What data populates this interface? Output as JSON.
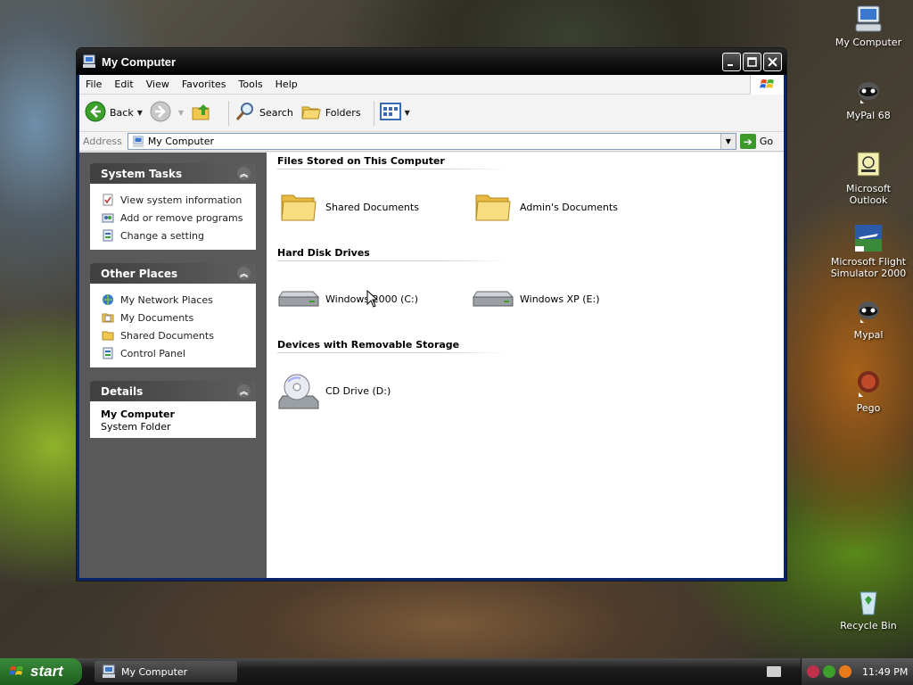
{
  "window": {
    "title": "My Computer",
    "icon": "my-computer-icon"
  },
  "menubar": {
    "items": [
      "File",
      "Edit",
      "View",
      "Favorites",
      "Tools",
      "Help"
    ]
  },
  "toolbar": {
    "back_label": "Back",
    "search_label": "Search",
    "folders_label": "Folders"
  },
  "addressbar": {
    "label": "Address",
    "value": "My Computer",
    "go_label": "Go"
  },
  "sidebar": {
    "system_tasks": {
      "title": "System Tasks",
      "items": [
        {
          "label": "View system information",
          "icon": "system-info-icon"
        },
        {
          "label": "Add or remove programs",
          "icon": "add-remove-programs-icon"
        },
        {
          "label": "Change a setting",
          "icon": "control-panel-icon"
        }
      ]
    },
    "other_places": {
      "title": "Other Places",
      "items": [
        {
          "label": "My Network Places",
          "icon": "network-places-icon"
        },
        {
          "label": "My Documents",
          "icon": "my-documents-icon"
        },
        {
          "label": "Shared Documents",
          "icon": "folder-icon"
        },
        {
          "label": "Control Panel",
          "icon": "control-panel-icon"
        }
      ]
    },
    "details": {
      "title": "Details",
      "name": "My Computer",
      "type": "System Folder"
    }
  },
  "main": {
    "groups": [
      {
        "title": "Files Stored on This Computer",
        "items": [
          {
            "label": "Shared Documents",
            "icon": "folder-icon"
          },
          {
            "label": "Admin's Documents",
            "icon": "folder-icon"
          }
        ]
      },
      {
        "title": "Hard Disk Drives",
        "items": [
          {
            "label": "Windows 2000 (C:)",
            "icon": "hard-disk-icon"
          },
          {
            "label": "Windows XP (E:)",
            "icon": "hard-disk-icon"
          }
        ]
      },
      {
        "title": "Devices with Removable Storage",
        "items": [
          {
            "label": "CD Drive (D:)",
            "icon": "cd-drive-icon"
          }
        ]
      }
    ]
  },
  "desktop": {
    "icons": [
      {
        "label": "My Computer",
        "icon": "my-computer-icon"
      },
      {
        "label": "MyPal 68",
        "icon": "mypal-icon"
      },
      {
        "label": "Microsoft Outlook",
        "icon": "outlook-icon"
      },
      {
        "label": "Microsoft Flight Simulator 2000",
        "icon": "flight-simulator-icon"
      },
      {
        "label": "Mypal",
        "icon": "mypal-icon"
      },
      {
        "label": "Pego",
        "icon": "pego-icon"
      },
      {
        "label": "Recycle Bin",
        "icon": "recycle-bin-icon"
      }
    ]
  },
  "taskbar": {
    "start_label": "start",
    "tasks": [
      {
        "label": "My Computer",
        "icon": "my-computer-icon"
      }
    ],
    "clock": "11:49 PM"
  }
}
